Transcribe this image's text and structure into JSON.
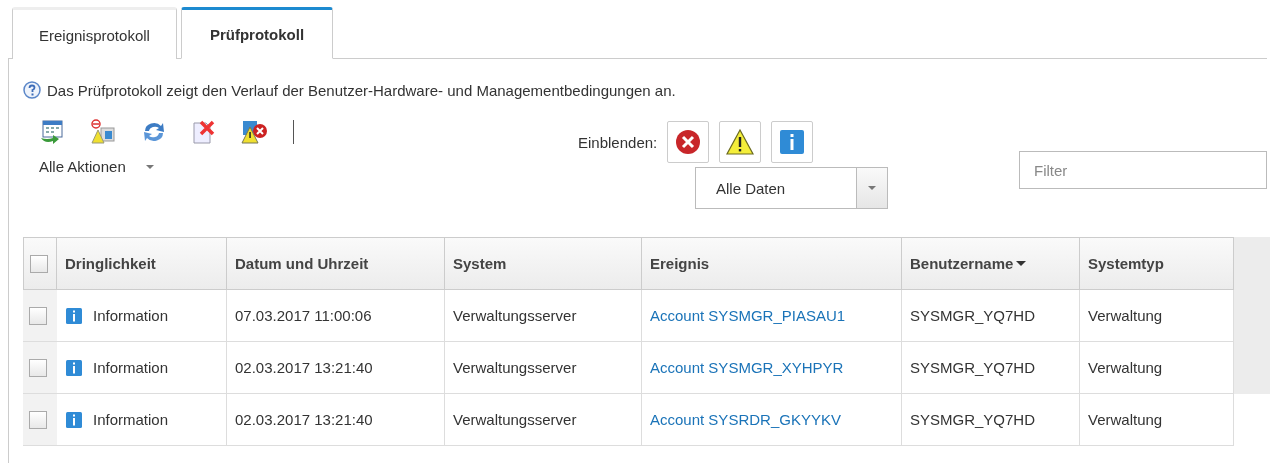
{
  "tabs": [
    {
      "label": "Ereignisprotokoll",
      "selected": false
    },
    {
      "label": "Prüfprotokoll",
      "selected": true
    }
  ],
  "description": "Das Prüfprotokoll zeigt den Verlauf der Benutzer-Hardware- und Managementbedingungen an.",
  "toolbar": {
    "actions": [
      {
        "kind": "export"
      },
      {
        "kind": "exclude"
      },
      {
        "kind": "refresh"
      },
      {
        "kind": "delete"
      },
      {
        "kind": "clear"
      }
    ],
    "actions_menu": "Alle Aktionen",
    "show_label": "Einblenden:",
    "severity_filters": [
      {
        "kind": "error"
      },
      {
        "kind": "warning"
      },
      {
        "kind": "info"
      }
    ],
    "time_range": "Alle Daten",
    "filter": {
      "placeholder": "Filter"
    }
  },
  "table": {
    "header_checked": false,
    "columns": [
      {
        "label": "Dringlichkeit",
        "sorted": false
      },
      {
        "label": "Datum und Uhrzeit",
        "sorted": false
      },
      {
        "label": "System",
        "sorted": false
      },
      {
        "label": "Ereignis",
        "sorted": false
      },
      {
        "label": "Benutzername",
        "sorted": true
      },
      {
        "label": "Systemtyp",
        "sorted": false
      }
    ],
    "rows": [
      {
        "checked": false,
        "severity": "Information",
        "kind": "info",
        "date": "07.03.2017 11:00:06",
        "system": "Verwaltungsserver",
        "event": "Account SYSMGR_PIASAU1",
        "user": "SYSMGR_YQ7HD",
        "system_type": "Verwaltung"
      },
      {
        "checked": false,
        "severity": "Information",
        "kind": "info",
        "date": "02.03.2017 13:21:40",
        "system": "Verwaltungsserver",
        "event": "Account SYSMGR_XYHPYR",
        "user": "SYSMGR_YQ7HD",
        "system_type": "Verwaltung"
      },
      {
        "checked": false,
        "severity": "Information",
        "kind": "info",
        "date": "02.03.2017 13:21:40",
        "system": "Verwaltungsserver",
        "event": "Account SYSRDR_GKYYKV",
        "user": "SYSMGR_YQ7HD",
        "system_type": "Verwaltung"
      }
    ]
  }
}
